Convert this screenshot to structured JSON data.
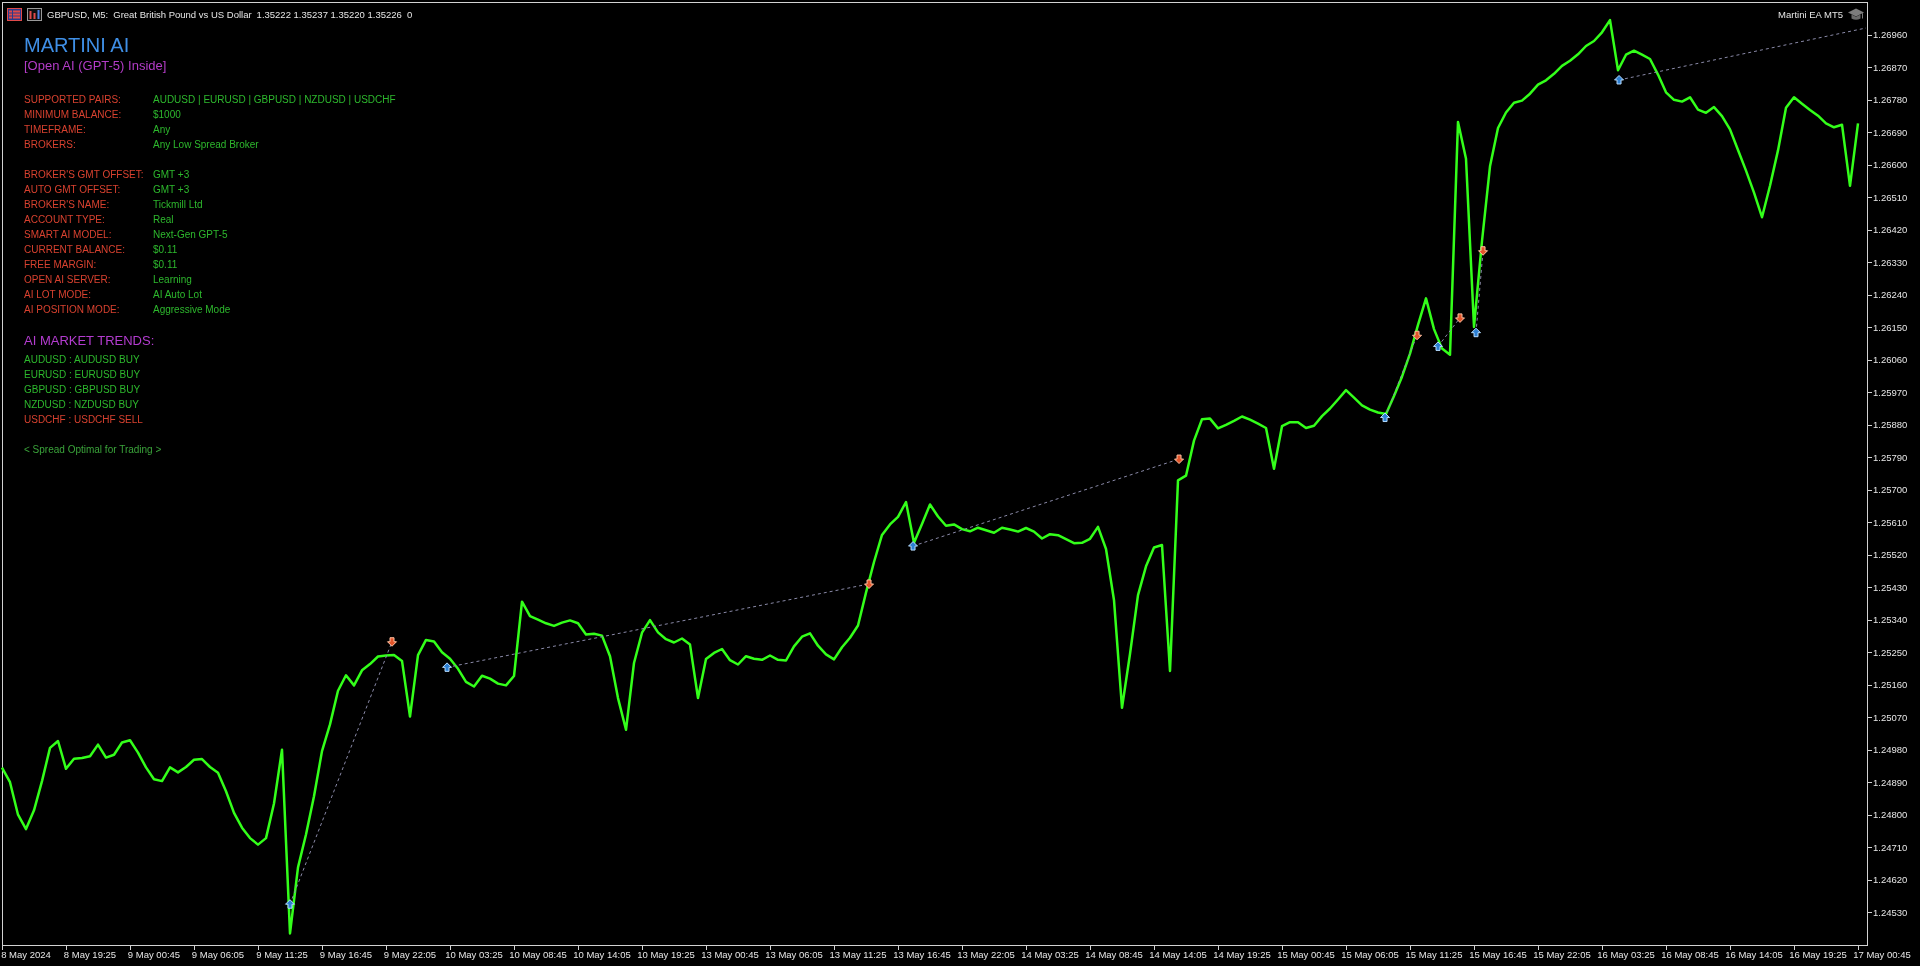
{
  "chart_header": {
    "symbol": "GBPUSD, M5:",
    "description": "Great British Pound vs US Dollar",
    "prices": "1.35222 1.35237 1.35220 1.35226",
    "volume": "0"
  },
  "expert_label": "Martini EA MT5",
  "info_panel": {
    "title": "MARTINI AI",
    "subtitle": "[Open AI (GPT-5) Inside]",
    "sections": [
      {
        "rows": [
          {
            "label": "SUPPORTED PAIRS:",
            "value": "AUDUSD | EURUSD | GBPUSD | NZDUSD | USDCHF"
          },
          {
            "label": "MINIMUM BALANCE:",
            "value": "$1000"
          },
          {
            "label": "TIMEFRAME:",
            "value": "Any"
          },
          {
            "label": "BROKERS:",
            "value": "Any Low Spread Broker"
          }
        ]
      },
      {
        "rows": [
          {
            "label": "BROKER'S GMT OFFSET:",
            "value": "GMT +3"
          },
          {
            "label": "AUTO GMT OFFSET:",
            "value": "GMT +3"
          },
          {
            "label": "BROKER'S NAME:",
            "value": "Tickmill Ltd"
          },
          {
            "label": "ACCOUNT TYPE:",
            "value": "Real"
          },
          {
            "label": "SMART AI MODEL:",
            "value": "Next-Gen GPT-5"
          },
          {
            "label": "CURRENT BALANCE:",
            "value": "$0.11"
          },
          {
            "label": "FREE MARGIN:",
            "value": "$0.11"
          },
          {
            "label": "OPEN AI SERVER:",
            "value": "Learning"
          },
          {
            "label": "AI LOT MODE:",
            "value": "AI Auto Lot"
          },
          {
            "label": "AI POSITION MODE:",
            "value": "Aggressive Mode"
          }
        ]
      }
    ],
    "trends_title": "AI MARKET TRENDS:",
    "trends": [
      {
        "text": "AUDUSD : AUDUSD BUY",
        "kind": "buy"
      },
      {
        "text": "EURUSD : EURUSD BUY",
        "kind": "buy"
      },
      {
        "text": "GBPUSD : GBPUSD BUY",
        "kind": "buy"
      },
      {
        "text": "NZDUSD : NZDUSD BUY",
        "kind": "buy"
      },
      {
        "text": "USDCHF : USDCHF SELL",
        "kind": "sell"
      }
    ],
    "footer": "< Spread Optimal for Trading >"
  },
  "chart_data": {
    "type": "line",
    "ylim": [
      1.24439,
      1.27051
    ],
    "categories": [
      null,
      null,
      null,
      "8 May 2024",
      null,
      null,
      null,
      null,
      null,
      null,
      null,
      "8 May 19:25",
      null,
      null,
      null,
      null,
      null,
      null,
      null,
      "9 May 00:45",
      null,
      null,
      null,
      null,
      null,
      null,
      null,
      "9 May 06:05",
      null,
      null,
      null,
      null,
      null,
      null,
      null,
      "9 May 11:25",
      null,
      null,
      null,
      null,
      null,
      null,
      null,
      "9 May 16:45",
      null,
      null,
      null,
      null,
      null,
      null,
      null,
      "9 May 22:05",
      null,
      null,
      null,
      null,
      null,
      null,
      null,
      "10 May 03:25",
      null,
      null,
      null,
      null,
      null,
      null,
      null,
      "10 May 08:45",
      null,
      null,
      null,
      null,
      null,
      null,
      null,
      "10 May 14:05",
      null,
      null,
      null,
      null,
      null,
      null,
      null,
      "10 May 19:25",
      null,
      null,
      null,
      null,
      null,
      null,
      null,
      "13 May 00:45",
      null,
      null,
      null,
      null,
      null,
      null,
      null,
      "13 May 06:05",
      null,
      null,
      null,
      null,
      null,
      null,
      null,
      "13 May 11:25",
      null,
      null,
      null,
      null,
      null,
      null,
      null,
      "13 May 16:45",
      null,
      null,
      null,
      null,
      null,
      null,
      null,
      "13 May 22:05",
      null,
      null,
      null,
      null,
      null,
      null,
      null,
      "14 May 03:25",
      null,
      null,
      null,
      null,
      null,
      null,
      null,
      "14 May 08:45",
      null,
      null,
      null,
      null,
      null,
      null,
      null,
      "14 May 14:05",
      null,
      null,
      null,
      null,
      null,
      null,
      null,
      "14 May 19:25",
      null,
      null,
      null,
      null,
      null,
      null,
      null,
      "15 May 00:45",
      null,
      null,
      null,
      null,
      null,
      null,
      null,
      "15 May 06:05",
      null,
      null,
      null,
      null,
      null,
      null,
      null,
      "15 May 11:25",
      null,
      null,
      null,
      null,
      null,
      null,
      null,
      "15 May 16:45",
      null,
      null,
      null,
      null,
      null,
      null,
      null,
      "15 May 22:05",
      null,
      null,
      null,
      null,
      null,
      null,
      null,
      "16 May 03:25",
      null,
      null,
      null,
      null,
      null,
      null,
      null,
      "16 May 08:45",
      null,
      null,
      null,
      null,
      null,
      null,
      null,
      "16 May 14:05",
      null,
      null,
      null,
      null,
      null,
      null,
      null,
      "16 May 19:25",
      null,
      null,
      null,
      null,
      null,
      null,
      null,
      "17 May 00:45"
    ],
    "series": [
      {
        "color": "#33ff1a",
        "values": [
          1.2493,
          1.2489,
          1.248,
          1.2476,
          1.24812,
          1.24893,
          1.24985,
          1.25004,
          1.24927,
          1.24955,
          1.24957,
          1.24962,
          1.24994,
          1.24958,
          1.24966,
          1.25,
          1.25006,
          1.24972,
          1.24931,
          1.24898,
          1.24893,
          1.24931,
          1.24917,
          1.24932,
          1.24952,
          1.24954,
          1.24932,
          1.24916,
          1.24865,
          1.24805,
          1.24764,
          1.24735,
          1.24717,
          1.24735,
          1.24831,
          1.2498,
          1.24471,
          1.24654,
          1.24745,
          1.24851,
          1.24976,
          1.2505,
          1.25143,
          1.25186,
          1.25158,
          1.252,
          1.25217,
          1.25238,
          1.25241,
          1.25242,
          1.25226,
          1.25072,
          1.25242,
          1.25284,
          1.2528,
          1.2525,
          1.25232,
          1.25204,
          1.25168,
          1.25155,
          1.25185,
          1.25177,
          1.25163,
          1.25158,
          1.25184,
          1.2539,
          1.2535,
          1.2534,
          1.2533,
          1.25323,
          1.25332,
          1.25338,
          1.2533,
          1.25299,
          1.25301,
          1.25296,
          1.25239,
          1.25123,
          1.25035,
          1.2522,
          1.25304,
          1.25339,
          1.25305,
          1.25286,
          1.25277,
          1.25288,
          1.25271,
          1.25123,
          1.25231,
          1.25248,
          1.25259,
          1.25228,
          1.25216,
          1.25239,
          1.25232,
          1.25229,
          1.25241,
          1.25229,
          1.25227,
          1.25266,
          1.25293,
          1.25302,
          1.25268,
          1.25244,
          1.2523,
          1.25264,
          1.2529,
          1.25324,
          1.25415,
          1.255,
          1.25575,
          1.25604,
          1.25625,
          1.25666,
          1.25553,
          1.25605,
          1.25659,
          1.25626,
          1.256,
          1.25604,
          1.25591,
          1.25585,
          1.25595,
          1.25588,
          1.25581,
          1.25595,
          1.2559,
          1.25584,
          1.25594,
          1.25584,
          1.25565,
          1.25577,
          1.25574,
          1.25563,
          1.25552,
          1.25553,
          1.25564,
          1.25597,
          1.25536,
          1.25394,
          1.25096,
          1.25245,
          1.25408,
          1.25488,
          1.2554,
          1.25547,
          1.25198,
          1.25726,
          1.25739,
          1.25836,
          1.25895,
          1.25897,
          1.2587,
          1.2588,
          1.25891,
          1.25903,
          1.25894,
          1.25883,
          1.25871,
          1.25758,
          1.25876,
          1.25887,
          1.25887,
          1.25871,
          1.25877,
          1.25904,
          1.25925,
          1.2595,
          1.25976,
          1.25955,
          1.25934,
          1.25922,
          1.25914,
          1.2591,
          1.2596,
          1.26013,
          1.26077,
          1.26157,
          1.2623,
          1.26145,
          1.26091,
          1.26074,
          1.26719,
          1.26617,
          1.26151,
          1.26389,
          1.26596,
          1.26702,
          1.26745,
          1.26772,
          1.26778,
          1.26797,
          1.26822,
          1.26834,
          1.26852,
          1.26874,
          1.26888,
          1.26906,
          1.26929,
          1.26943,
          1.26967,
          1.27001,
          1.26862,
          1.26905,
          1.26916,
          1.26905,
          1.26893,
          1.2685,
          1.26801,
          1.2678,
          1.26775,
          1.26787,
          1.26753,
          1.26744,
          1.2676,
          1.26735,
          1.26698,
          1.26641,
          1.26584,
          1.26523,
          1.26455,
          1.26542,
          1.2664,
          1.26758,
          1.26787,
          1.26769,
          1.26752,
          1.26736,
          1.26715,
          1.26704,
          1.26711,
          1.26542,
          1.26715,
          null,
          null,
          null
        ]
      }
    ],
    "yticks": [
      {
        "value": 1.2453,
        "label": "1.24530"
      },
      {
        "value": 1.2462,
        "label": "1.24620"
      },
      {
        "value": 1.2471,
        "label": "1.24710"
      },
      {
        "value": 1.248,
        "label": "1.24800"
      },
      {
        "value": 1.2489,
        "label": "1.24890"
      },
      {
        "value": 1.2498,
        "label": "1.24980"
      },
      {
        "value": 1.2507,
        "label": "1.25070"
      },
      {
        "value": 1.2516,
        "label": "1.25160"
      },
      {
        "value": 1.2525,
        "label": "1.25250"
      },
      {
        "value": 1.2534,
        "label": "1.25340"
      },
      {
        "value": 1.2543,
        "label": "1.25430"
      },
      {
        "value": 1.2552,
        "label": "1.25520"
      },
      {
        "value": 1.2561,
        "label": "1.25610"
      },
      {
        "value": 1.257,
        "label": "1.25700"
      },
      {
        "value": 1.2579,
        "label": "1.25790"
      },
      {
        "value": 1.2588,
        "label": "1.25880"
      },
      {
        "value": 1.2597,
        "label": "1.25970"
      },
      {
        "value": 1.2606,
        "label": "1.26060"
      },
      {
        "value": 1.2615,
        "label": "1.26150"
      },
      {
        "value": 1.2624,
        "label": "1.26240"
      },
      {
        "value": 1.2633,
        "label": "1.26330"
      },
      {
        "value": 1.2642,
        "label": "1.26420"
      },
      {
        "value": 1.2651,
        "label": "1.26510"
      },
      {
        "value": 1.266,
        "label": "1.26600"
      },
      {
        "value": 1.2669,
        "label": "1.26690"
      },
      {
        "value": 1.2678,
        "label": "1.26780"
      },
      {
        "value": 1.2687,
        "label": "1.26870"
      },
      {
        "value": 1.2696,
        "label": "1.26960"
      }
    ]
  }
}
